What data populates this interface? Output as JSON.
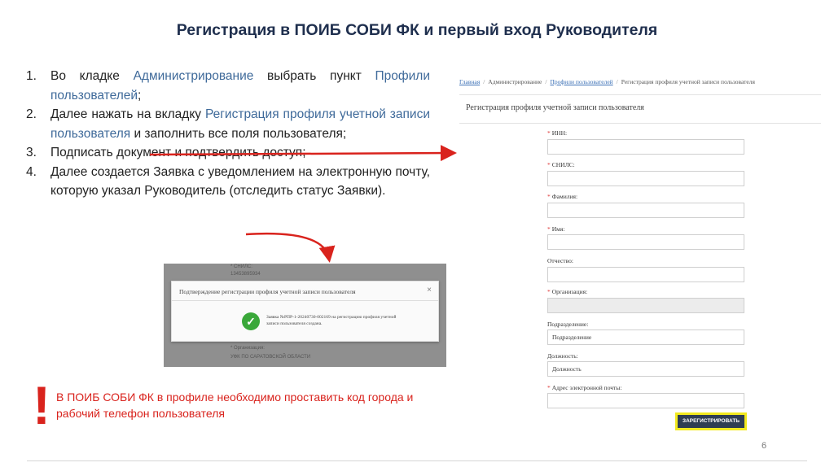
{
  "slide": {
    "title": "Регистрация в ПОИБ СОБИ ФК и первый вход Руководителя",
    "page_number": "6"
  },
  "steps": [
    {
      "num": "1.",
      "parts": [
        {
          "text": "Во кладке ",
          "hl": false
        },
        {
          "text": "Администрирование",
          "hl": true
        },
        {
          "text": " выбрать пункт ",
          "hl": false
        },
        {
          "text": "Профили пользователей",
          "hl": true
        },
        {
          "text": ";",
          "hl": false
        }
      ]
    },
    {
      "num": "2.",
      "parts": [
        {
          "text": "Далее нажать на вкладку ",
          "hl": false
        },
        {
          "text": "Регистрация профиля учетной записи пользователя",
          "hl": true
        },
        {
          "text": " и заполнить все поля пользователя;",
          "hl": false
        }
      ]
    },
    {
      "num": "3.",
      "parts": [
        {
          "text": "Подписать документ и подтвердить доступ;",
          "hl": false
        }
      ]
    },
    {
      "num": "4.",
      "parts": [
        {
          "text": "Далее создается Заявка с уведомлением на электронную почту, которую указал Руководитель (отследить статус Заявки).",
          "hl": false
        }
      ]
    }
  ],
  "modal": {
    "bg_top_label": "* СНИЛС:",
    "bg_top_value": "13453895934",
    "title": "Подтверждение регистрации профиля учетной записи пользователя",
    "close": "×",
    "message": "Заявка №РПР-1-20240730-002169 на регистрацию профиля учетной записи пользователя создана.",
    "bg_bottom_label": "* Организация:",
    "bg_bottom_value": "УФК ПО САРАТОВСКОЙ ОБЛАСТИ"
  },
  "warning": {
    "mark": "!",
    "text": "В ПОИБ СОБИ ФК в профиле необходимо проставить код города и рабочий телефон пользователя"
  },
  "form": {
    "breadcrumb": {
      "home": "Главная",
      "admin": "Администрирование",
      "profiles": "Профили пользователей",
      "current": "Регистрация профиля учетной записи пользователя"
    },
    "title": "Регистрация профиля учетной записи пользователя",
    "fields": [
      {
        "label": "ИНН:",
        "required": true,
        "value": ""
      },
      {
        "label": "СНИЛС:",
        "required": true,
        "value": ""
      },
      {
        "label": "Фамилия:",
        "required": true,
        "value": ""
      },
      {
        "label": "Имя:",
        "required": true,
        "value": ""
      },
      {
        "label": "Отчество:",
        "required": false,
        "value": ""
      },
      {
        "label": "Организация:",
        "required": true,
        "value": ""
      },
      {
        "label": "Подразделение:",
        "required": false,
        "value": "Подразделение"
      },
      {
        "label": "Должность:",
        "required": false,
        "value": "Должность"
      },
      {
        "label": "Адрес электронной почты:",
        "required": true,
        "value": ""
      }
    ],
    "submit": "ЗАРЕГИСТРИРОВАТЬ"
  },
  "colors": {
    "accent_red": "#d9231d",
    "highlight_blue": "#3f6a9a",
    "title_navy": "#1f2f4e",
    "button_highlight": "#f2ea1f"
  }
}
